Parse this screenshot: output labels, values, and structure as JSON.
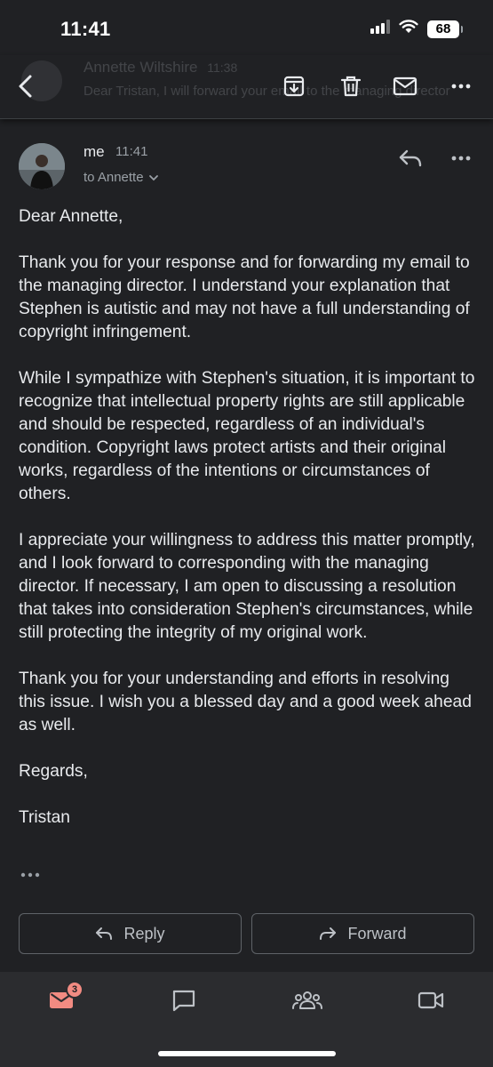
{
  "status_bar": {
    "time": "11:41",
    "battery": "68",
    "icons": [
      "signal-icon",
      "wifi-icon",
      "battery-icon"
    ]
  },
  "toolbar": {
    "behind_sender": "Annette Wiltshire",
    "behind_time": "11:38",
    "behind_snippet": "Dear Tristan, I will forward your email to the managing director",
    "icons": [
      "back-arrow-icon",
      "archive-icon",
      "delete-icon",
      "mark-unread-icon",
      "more-vert-icon"
    ]
  },
  "email": {
    "sender": "me",
    "time": "11:41",
    "recipient": "to Annette",
    "paragraphs": [
      "Dear Annette,",
      "Thank you for your response and for forwarding my email to the managing director. I understand your explanation that Stephen is autistic and may not have a full understanding of copyright infringement.",
      "While I sympathize with Stephen's situation, it is important to recognize that intellectual property rights are still applicable and should be respected, regardless of an individual's condition. Copyright laws protect artists and their original works, regardless of the intentions or circumstances of others.",
      "I appreciate your willingness to address this matter promptly, and I look forward to corresponding with the managing director. If necessary, I am open to discussing a resolution that takes into consideration Stephen's circumstances, while still protecting the integrity of my original work.",
      "Thank you for your understanding and efforts in resolving this issue. I wish you a blessed day and a good week ahead as well.",
      "Regards,",
      "Tristan"
    ]
  },
  "actions": {
    "reply_label": "Reply",
    "forward_label": "Forward"
  },
  "bottom_nav": {
    "mail_badge": "3",
    "items": [
      "mail-icon",
      "chat-icon",
      "spaces-icon",
      "meet-icon"
    ]
  },
  "colors": {
    "background": "#202124",
    "nav_background": "#2b2c2f",
    "text": "#e8eaed",
    "muted": "#9aa0a6",
    "active_accent": "#f28b82"
  }
}
